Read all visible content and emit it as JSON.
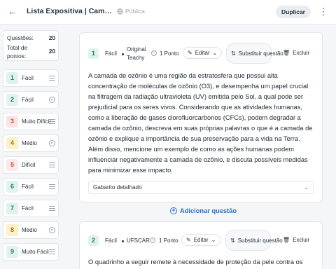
{
  "header": {
    "title": "Lista Expositiva | Camada de ozônio",
    "visibility": "Pública",
    "duplicate_label": "Duplicar"
  },
  "summary": {
    "questions_label": "Questões:",
    "questions_value": "20",
    "points_label": "Total de pontos:",
    "points_value": "20"
  },
  "sidebar": {
    "items": [
      {
        "num": "1",
        "label": "Fácil",
        "color": "green",
        "icon": "lines-icon"
      },
      {
        "num": "2",
        "label": "Fácil",
        "color": "green",
        "icon": "radio-icon"
      },
      {
        "num": "3",
        "label": "Muito Difícil",
        "color": "red",
        "icon": "lines-icon"
      },
      {
        "num": "4",
        "label": "Médio",
        "color": "yellow",
        "icon": "radio-icon"
      },
      {
        "num": "5",
        "label": "Difícil",
        "color": "pink",
        "icon": "lines-icon"
      },
      {
        "num": "6",
        "label": "Fácil",
        "color": "green",
        "icon": "lines-icon"
      },
      {
        "num": "7",
        "label": "Fácil",
        "color": "green",
        "icon": "lines-icon"
      },
      {
        "num": "8",
        "label": "Médio",
        "color": "yellow",
        "icon": "radio-icon"
      },
      {
        "num": "9",
        "label": "Muito Fácil",
        "color": "green",
        "icon": "lines-icon"
      }
    ]
  },
  "questions": [
    {
      "num": "1",
      "difficulty": "Fácil",
      "source": "Original Teachy",
      "points": "1 Ponto",
      "edit_label": "Editar",
      "replace_label": "Substituir questão",
      "delete_label": "Excluir",
      "text": "A camada de ozônio é uma região da estratosfera que possui alta concentração de moléculas de ozônio (O3), e desempenha um papel crucial na filtragem da radiação ultravioleta (UV) emitida pelo Sol, a qual pode ser prejudicial para os seres vivos. Considerando que as atividades humanas, como a liberação de gases clorofluorcarbonos (CFCs), podem degradar a camada de ozônio, descreva em suas próprias palavras o que é a camada de ozônio e explique a importância de sua preservação para a vida na Terra. Além disso, mencione um exemplo de como as ações humanas podem influenciar negativamente a camada de ozônio, e discuta possíveis medidas para minimizar esse impacto.",
      "answer_label": "Gabarito detalhado"
    },
    {
      "num": "2",
      "difficulty": "Fácil",
      "source": "UFSCAR",
      "points": "1 Ponto",
      "edit_label": "Editar",
      "replace_label": "Substituir questão",
      "delete_label": "Excluir",
      "text": "O quadrinho a seguir remete à necessidade de proteção da pele contra os"
    }
  ],
  "add_question_label": "Adicionar questão",
  "colors": {
    "accent": "#2a6ec7",
    "green": "#2c7a66",
    "red": "#c44a4a",
    "yellow": "#9b7412"
  }
}
